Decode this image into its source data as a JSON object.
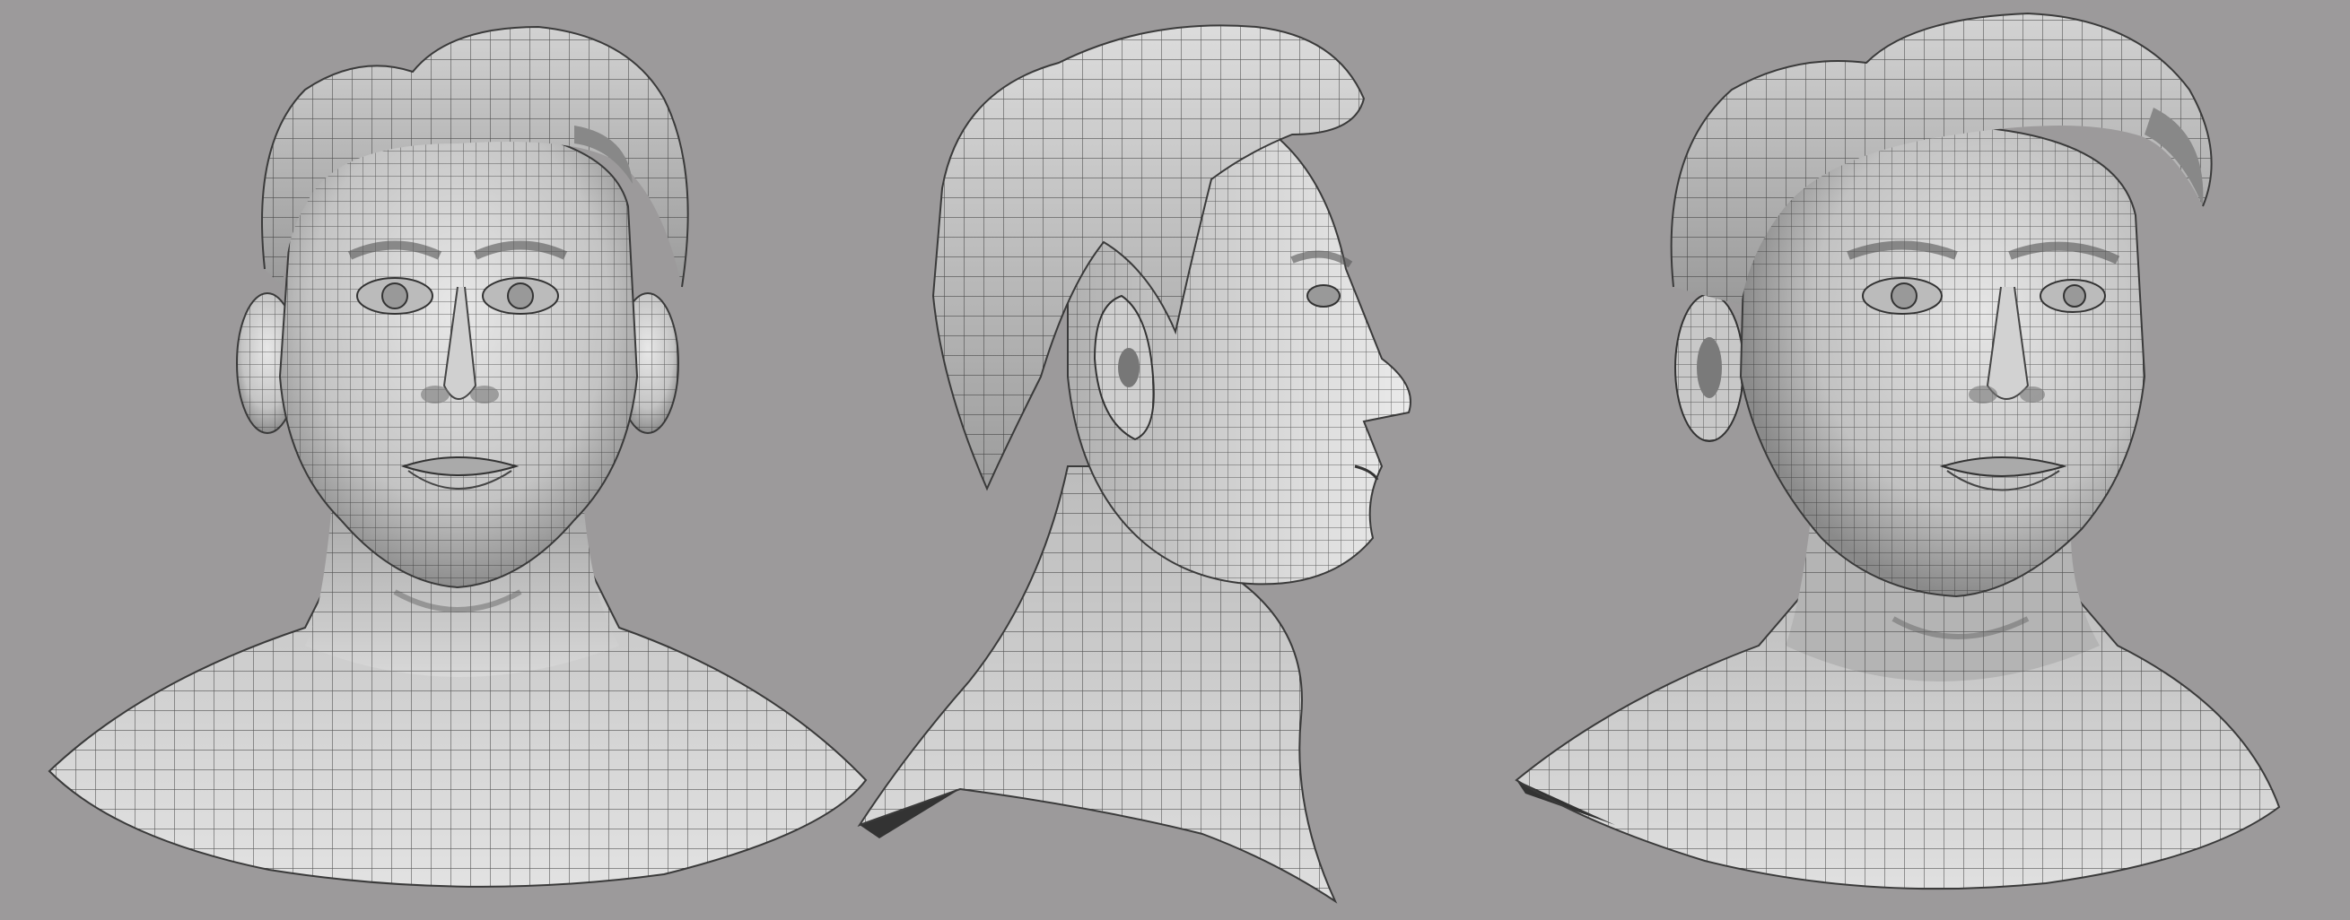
{
  "scene": {
    "background_color": "#9c9a9b",
    "model_color": "#d6d6d6",
    "shadow_color": "#5a5a5a",
    "wire_color": "#2a2a2a",
    "views": [
      {
        "name": "front",
        "icon": "head-front-view"
      },
      {
        "name": "side",
        "icon": "head-side-view"
      },
      {
        "name": "three-quarter",
        "icon": "head-three-quarter-view"
      }
    ]
  }
}
